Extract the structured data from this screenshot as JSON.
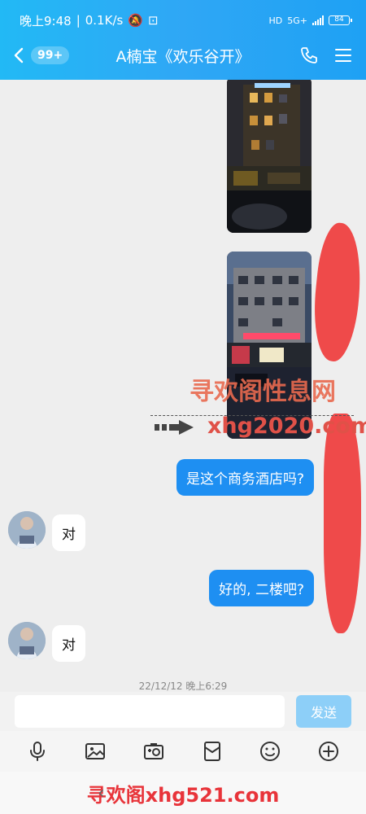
{
  "status": {
    "time": "晚上9:48",
    "speed": "0.1K/s",
    "net": "5G+",
    "battery": "84"
  },
  "header": {
    "unread": "99+",
    "title": "A楠宝《欢乐谷开》"
  },
  "messages": {
    "q1": "是这个商务酒店吗?",
    "a1": "对",
    "q2": "好的, 二楼吧?",
    "a2": "对",
    "timestamp": "22/12/12 晚上6:29"
  },
  "watermark": {
    "line1": "寻欢阁性息网",
    "line2": "xhg2020.com",
    "bottom": "寻欢阁xhg521.com"
  },
  "input": {
    "placeholder": "",
    "send_label": "发送"
  },
  "colors": {
    "header": "#22b9f5",
    "bubble": "#1e8ff2",
    "send": "#8dcff8",
    "redact": "#ef4a4a"
  }
}
